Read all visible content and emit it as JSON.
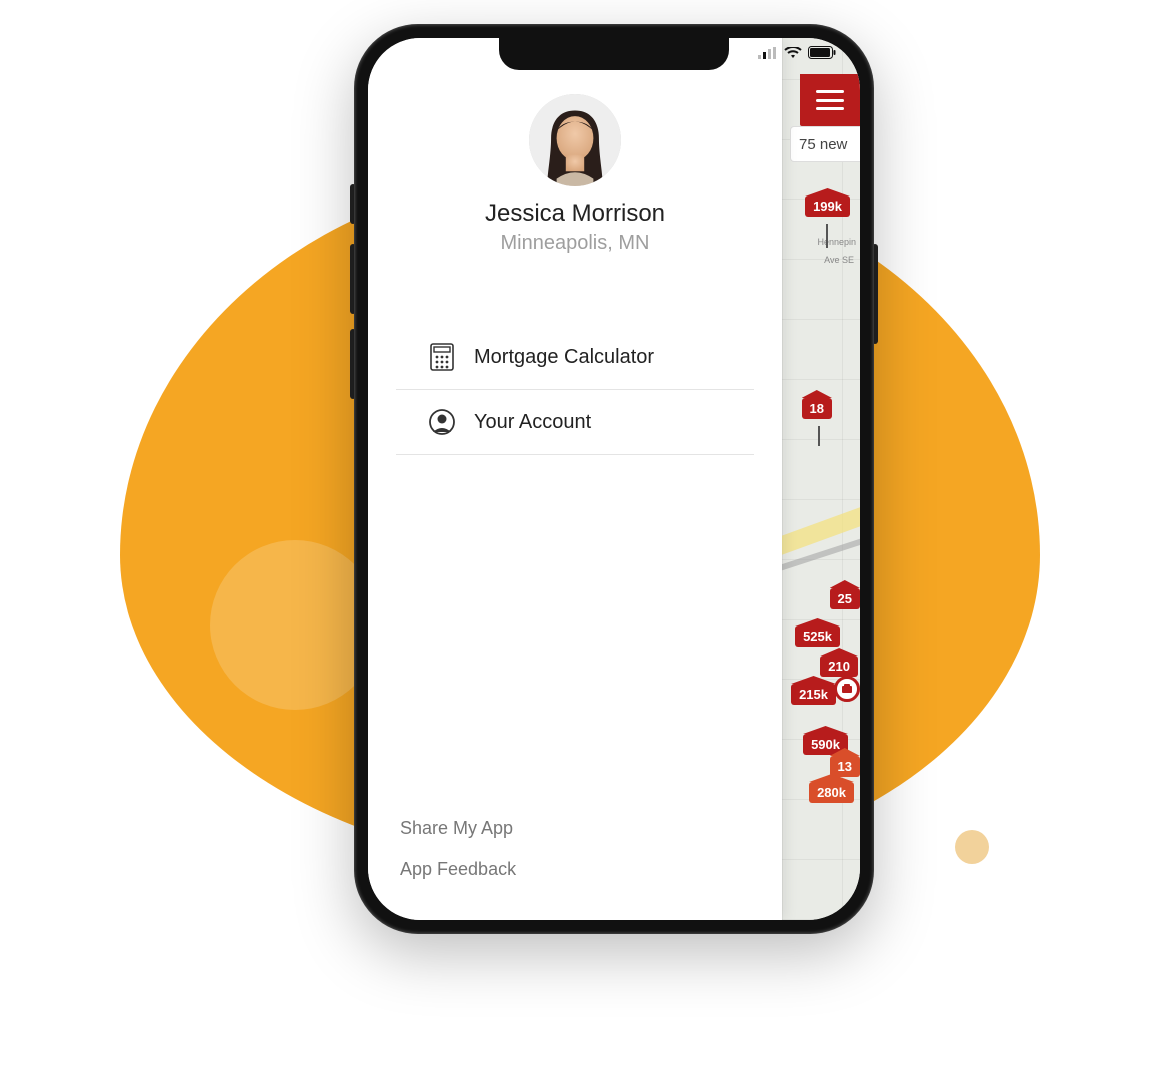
{
  "colors": {
    "accent_orange": "#f5a623",
    "brand_red": "#b71c1c",
    "pin_orange": "#d94e2a"
  },
  "profile": {
    "name": "Jessica Morrison",
    "location": "Minneapolis, MN"
  },
  "menu": {
    "items": [
      {
        "label": "Mortgage Calculator",
        "icon": "calculator-icon"
      },
      {
        "label": "Your Account",
        "icon": "account-icon"
      }
    ]
  },
  "footer": {
    "share": "Share My App",
    "feedback": "App Feedback"
  },
  "header": {
    "new_bar": "75 new"
  },
  "map": {
    "street_labels": [
      "Hennepin",
      "Ave SE"
    ],
    "pins": [
      "199k",
      "18",
      "25",
      "525k",
      "210",
      "215k",
      "590k",
      "13",
      "280k"
    ]
  },
  "statusbar": {
    "signal_icon": "cellular-signal-icon",
    "wifi_icon": "wifi-icon",
    "battery_icon": "battery-icon"
  }
}
